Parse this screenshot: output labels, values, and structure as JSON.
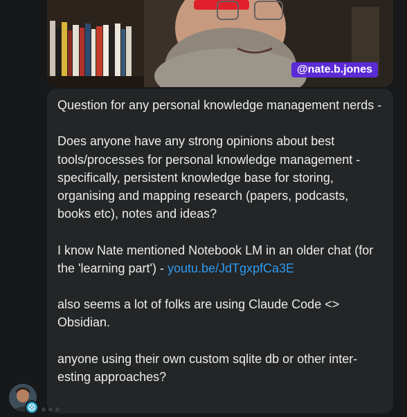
{
  "video": {
    "handle": "@nate.b.jones"
  },
  "message": {
    "paragraphs": [
      {
        "text": "Question for any personal knowledge management nerds -"
      },
      {
        "text": "Does anyone have any strong opinions about best tools/processes for personal knowledge management - specifically, persistent knowledge base for storing, organising and mapping research (papers, podcasts, books etc), notes and ideas?"
      },
      {
        "text": "I know Nate mentioned Notebook LM in an older chat (for the 'learning part') - ",
        "link": "youtu.be/JdTgxpfCa3E"
      },
      {
        "text": "also seems a lot of folks are using Claude Code <> Obsidian."
      },
      {
        "text": "anyone using their own custom sqlite db or other inter- esting approaches?"
      }
    ]
  },
  "colors": {
    "background": "#161819",
    "bubble": "#232526",
    "text": "#ececec",
    "link": "#2f9bf0",
    "handle_tag": "#5b2bd6",
    "badge": "#2aa6c9"
  },
  "icons": {
    "avatar": "user-avatar",
    "badge": "bot-badge-icon",
    "typing": "typing-indicator"
  }
}
